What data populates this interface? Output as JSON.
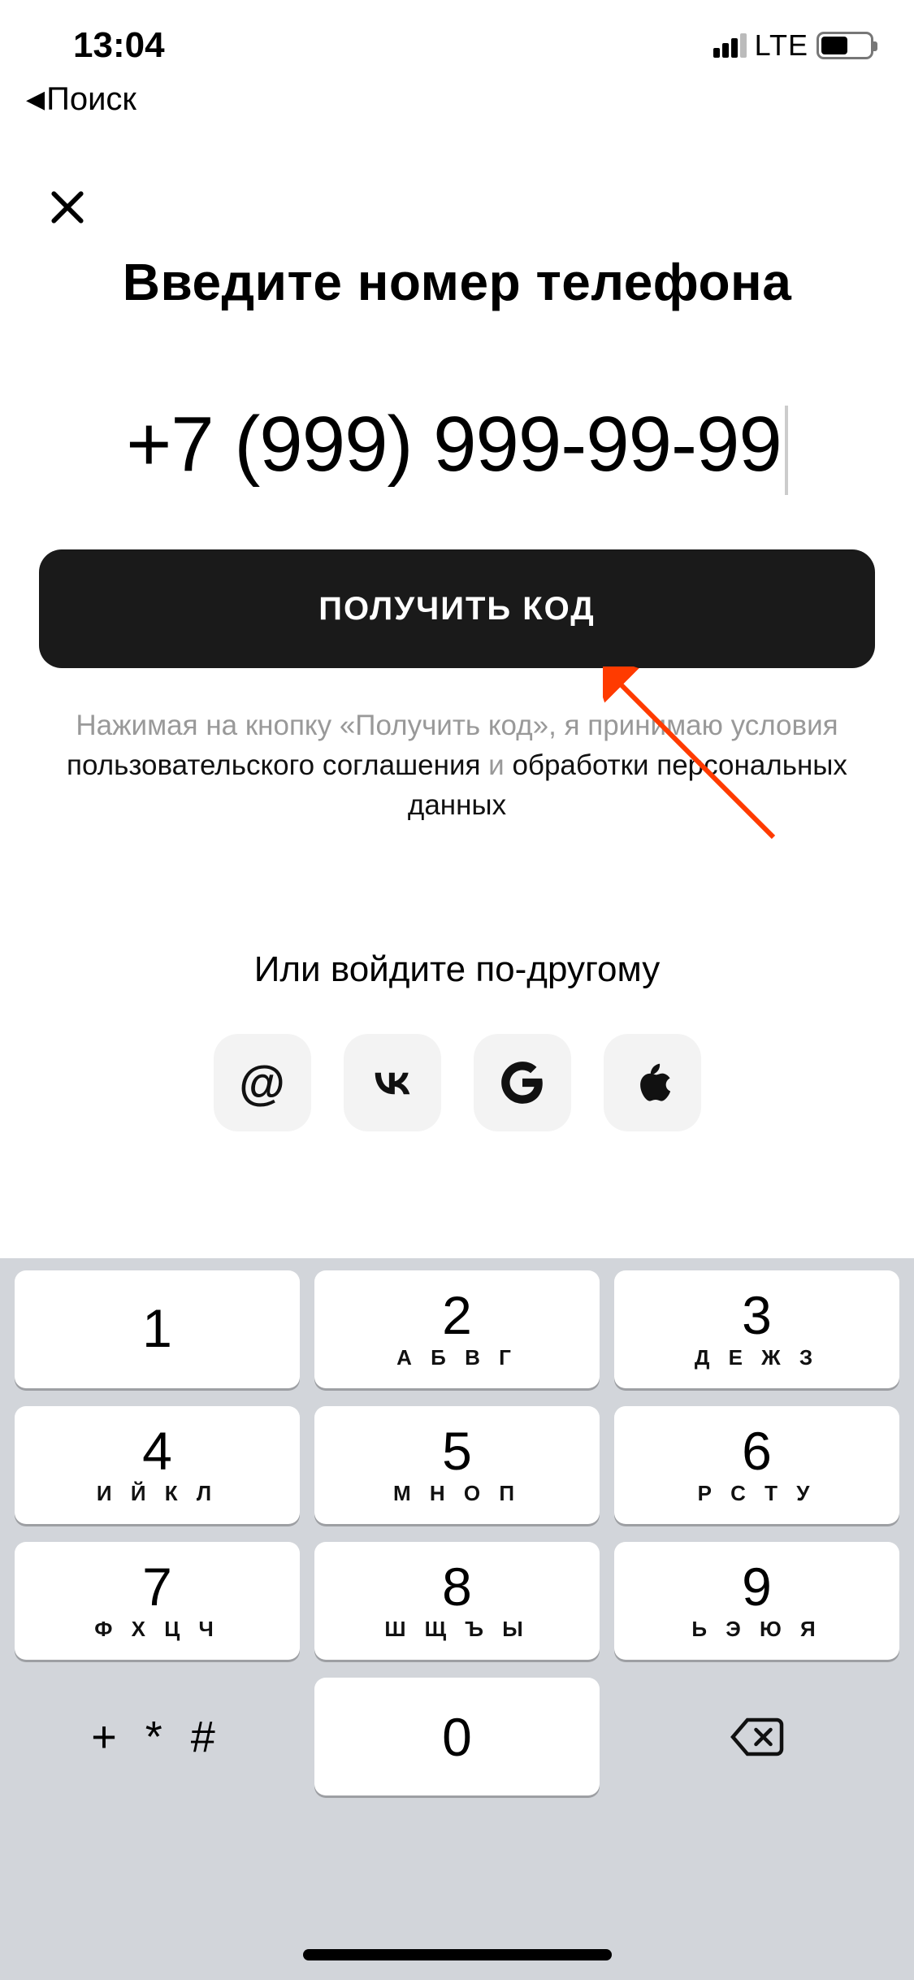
{
  "status": {
    "time": "13:04",
    "network": "LTE"
  },
  "nav": {
    "back_label": "Поиск"
  },
  "title": "Введите номер телефона",
  "phone_value": "+7 (999) 999-99-99",
  "primary_button": "ПОЛУЧИТЬ КОД",
  "disclaimer": {
    "part1": "Нажимая на кнопку «Получить код», я принимаю условия",
    "link1": "пользовательского соглашения",
    "and": " и ",
    "link2": "обработки персональных данных"
  },
  "alt_login_title": "Или войдите по-другому",
  "social": {
    "mail": "@",
    "vk": "VK",
    "google": "G",
    "apple": "Apple"
  },
  "keypad": {
    "keys": [
      {
        "digit": "1",
        "letters": ""
      },
      {
        "digit": "2",
        "letters": "А Б В Г"
      },
      {
        "digit": "3",
        "letters": "Д Е Ж З"
      },
      {
        "digit": "4",
        "letters": "И Й К Л"
      },
      {
        "digit": "5",
        "letters": "М Н О П"
      },
      {
        "digit": "6",
        "letters": "Р С Т У"
      },
      {
        "digit": "7",
        "letters": "Ф Х Ц Ч"
      },
      {
        "digit": "8",
        "letters": "Ш Щ Ъ Ы"
      },
      {
        "digit": "9",
        "letters": "Ь Э Ю Я"
      },
      {
        "digit": "0",
        "letters": ""
      }
    ],
    "symbols": "+ * #"
  }
}
